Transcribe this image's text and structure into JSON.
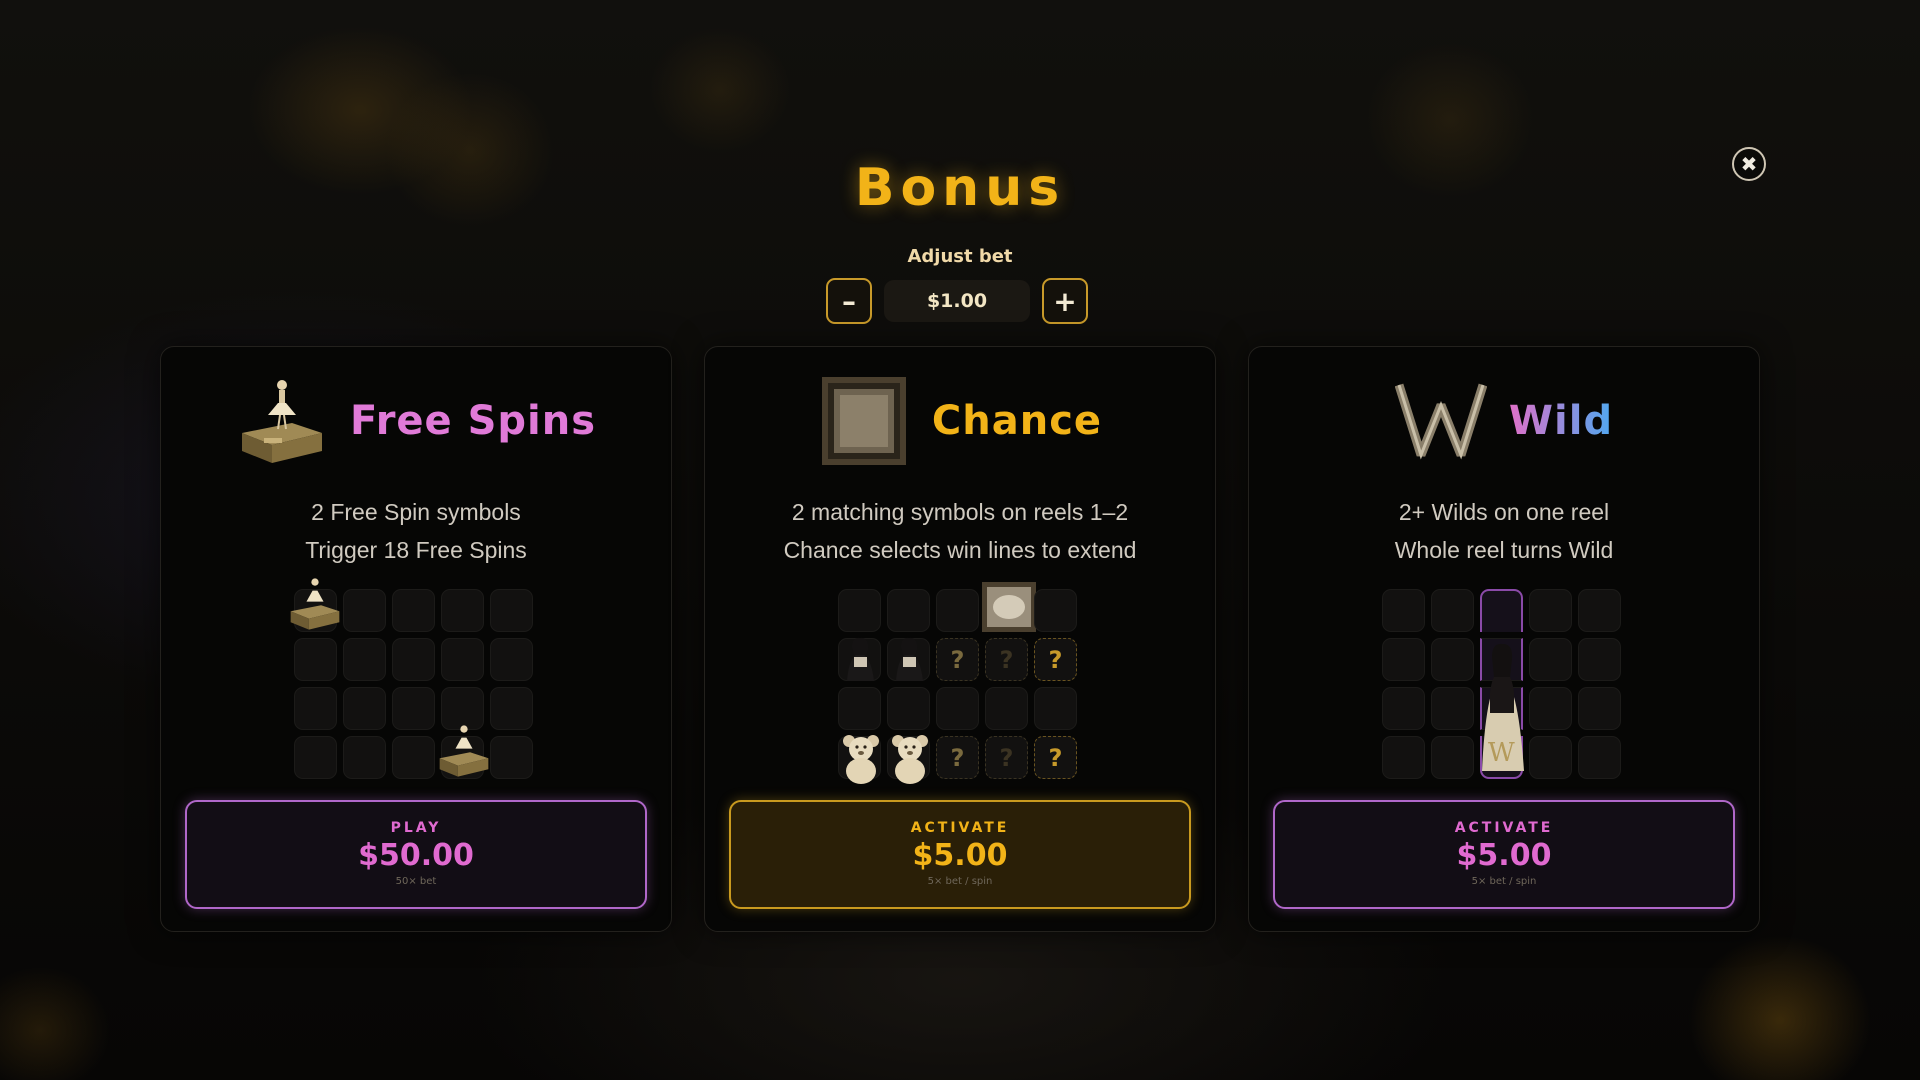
{
  "title": "Bonus",
  "close_icon": "close-icon",
  "bet": {
    "label": "Adjust bet",
    "value": "$1.00",
    "minus_label": "–",
    "plus_label": "+"
  },
  "cards": [
    {
      "title": "Free Spins",
      "title_color": "#e07ad8",
      "icon": "music-box-icon",
      "desc1": "2 Free Spin symbols",
      "desc2": "Trigger 18 Free Spins",
      "action_label": "PLAY",
      "price": "$50.00",
      "sub": "50× bet",
      "accent": "#e06ad0"
    },
    {
      "title": "Chance",
      "title_color": "#f2b318",
      "icon": "picture-frame-icon",
      "desc1": "2 matching symbols on reels 1–2",
      "desc2": "Chance selects win lines to extend",
      "action_label": "ACTIVATE",
      "price": "$5.00",
      "sub": "5× bet / spin",
      "accent": "#f2b318"
    },
    {
      "title": "Wild",
      "title_color": "#c070e0",
      "icon": "wild-w-icon",
      "desc1": "2+ Wilds on one reel",
      "desc2": "Whole reel turns Wild",
      "action_label": "ACTIVATE",
      "price": "$5.00",
      "sub": "5× bet / spin",
      "accent": "#e06ad0"
    }
  ],
  "chance_grid_marks": "?"
}
